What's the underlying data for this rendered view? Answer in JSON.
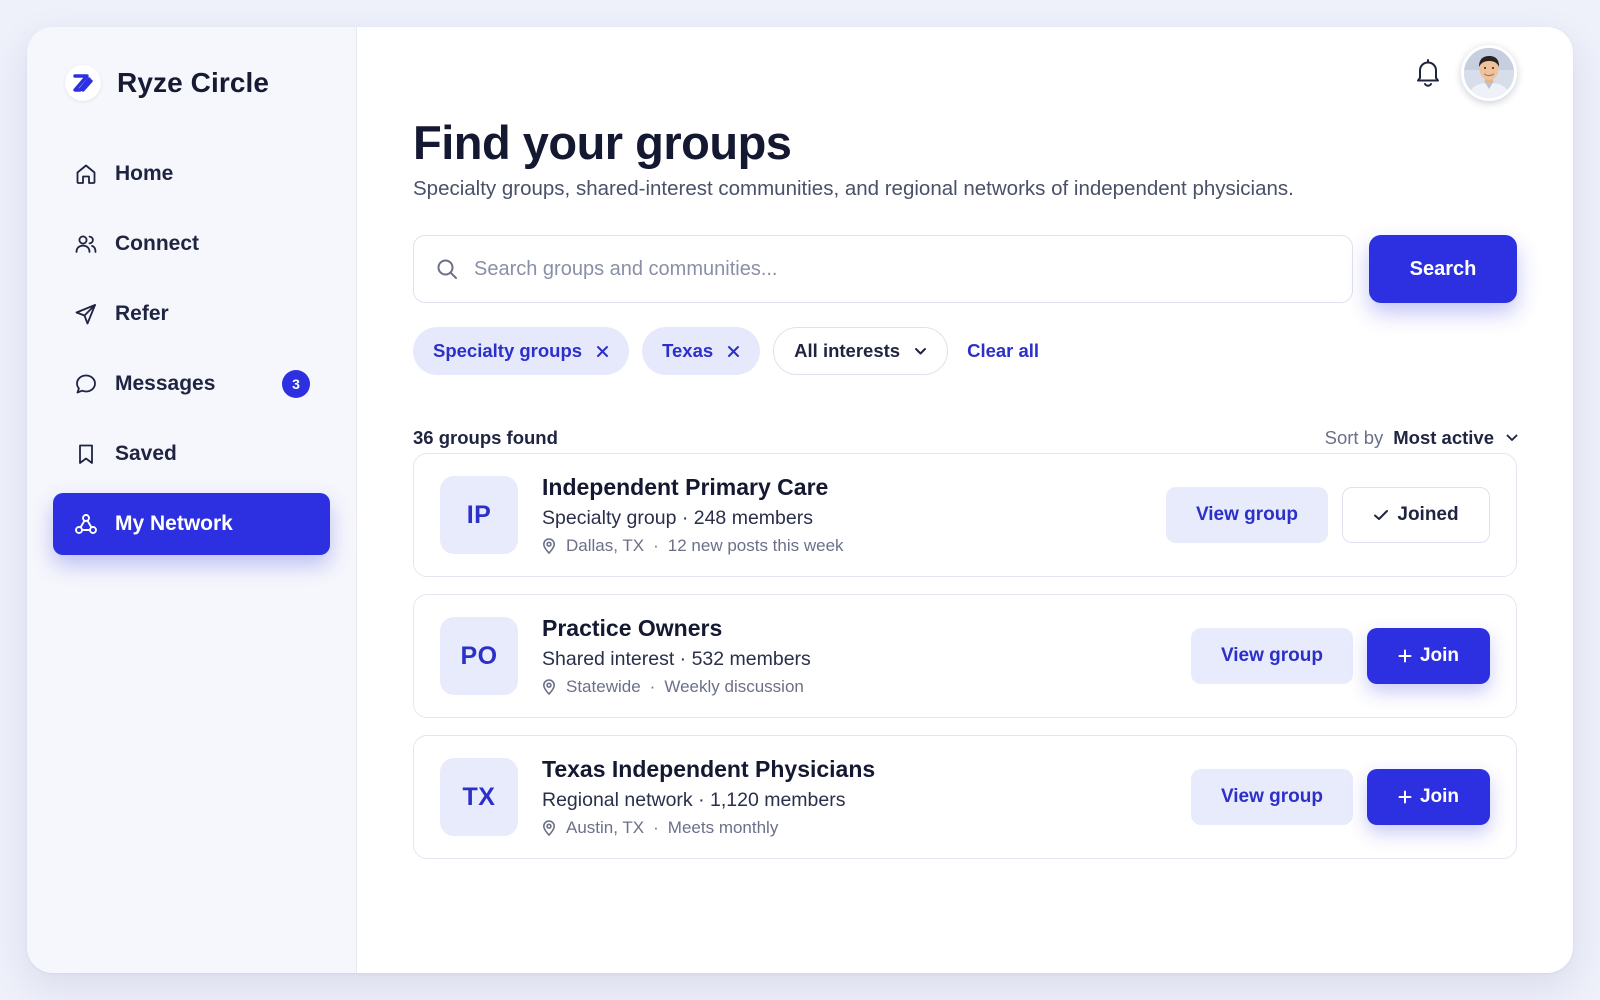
{
  "app": {
    "name": "Ryze Circle"
  },
  "colors": {
    "accent": "#2c30e0",
    "accent_soft": "#e8ebfc",
    "text": "#141830",
    "muted": "#6b7088"
  },
  "sidebar": {
    "items": [
      {
        "label": "Home",
        "icon": "home-icon"
      },
      {
        "label": "Connect",
        "icon": "users-icon"
      },
      {
        "label": "Refer",
        "icon": "send-icon"
      },
      {
        "label": "Messages",
        "icon": "message-icon",
        "badge": "3"
      },
      {
        "label": "Saved",
        "icon": "bookmark-icon"
      },
      {
        "label": "My Network",
        "icon": "network-icon",
        "active": true
      }
    ]
  },
  "header": {
    "bell_icon": "bell-icon",
    "avatar": "user-avatar"
  },
  "page": {
    "title": "Find your groups",
    "subtitle": "Specialty groups, shared-interest communities, and regional networks of independent physicians."
  },
  "search": {
    "placeholder": "Search groups and communities...",
    "value": "",
    "button_label": "Search"
  },
  "filters": {
    "chips": [
      "Specialty groups",
      "Texas"
    ],
    "interests_dropdown": "All interests",
    "clear_label": "Clear all"
  },
  "results": {
    "count_label": "36 groups found",
    "sort_label": "Sort by",
    "sort_value": "Most active"
  },
  "groups": [
    {
      "initials": "IP",
      "name": "Independent Primary Care",
      "subtitle": "Specialty group · 248 members",
      "location": "Dallas, TX",
      "activity": "12 new posts this week",
      "view_label": "View group",
      "action_label": "Joined",
      "joined": true
    },
    {
      "initials": "PO",
      "name": "Practice Owners",
      "subtitle": "Shared interest · 532 members",
      "location": "Statewide",
      "activity": "Weekly discussion",
      "view_label": "View group",
      "action_label": "Join",
      "joined": false
    },
    {
      "initials": "TX",
      "name": "Texas Independent Physicians",
      "subtitle": "Regional network · 1,120 members",
      "location": "Austin, TX",
      "activity": "Meets monthly",
      "view_label": "View group",
      "action_label": "Join",
      "joined": false
    }
  ],
  "meta_separator": "·"
}
